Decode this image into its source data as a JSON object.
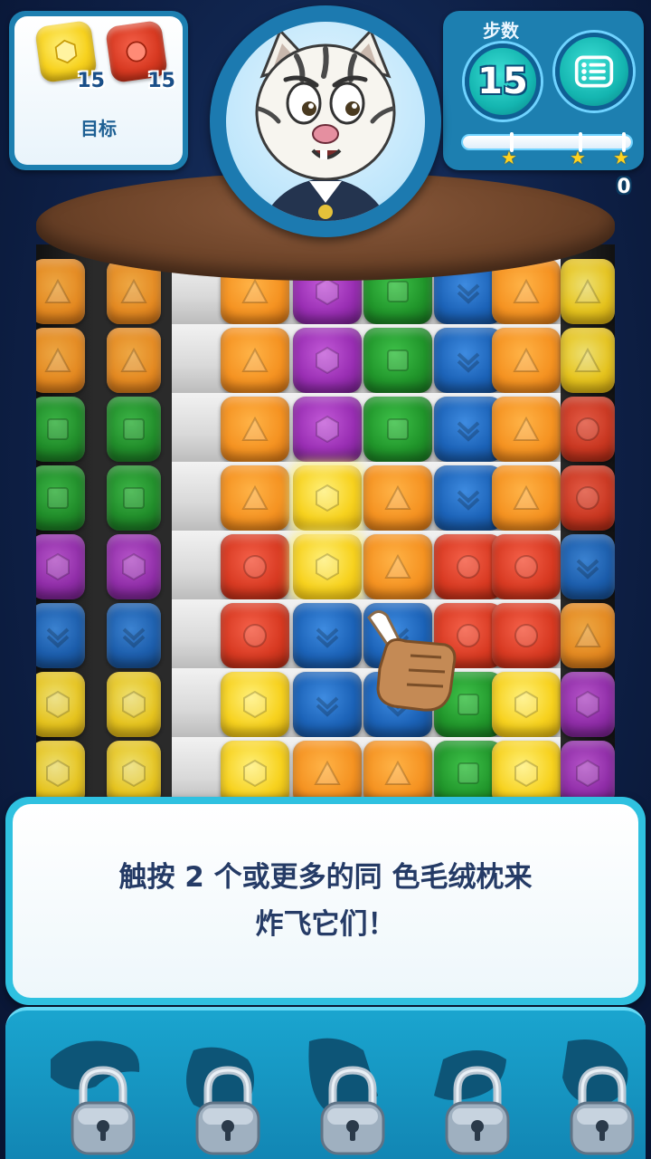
{
  "goal": {
    "label": "目标",
    "items": [
      {
        "color": "yellow",
        "icon": "hexagon-icon",
        "count": "15"
      },
      {
        "color": "red",
        "icon": "circle-icon",
        "count": "15"
      }
    ]
  },
  "moves": {
    "label": "步数",
    "value": "15"
  },
  "menu": {
    "icon": "menu-icon"
  },
  "score": {
    "value": "0",
    "stars": 3
  },
  "character": {
    "icon": "tiger-character"
  },
  "board": {
    "rows": [
      [
        "orange-triangle",
        "orange-triangle",
        "white",
        "orange-triangle",
        "purple-hexagon",
        "green-square",
        "blue-chevron",
        "orange-triangle",
        "yellow-triangle"
      ],
      [
        "orange-triangle",
        "orange-triangle",
        "white",
        "orange-triangle",
        "purple-hexagon",
        "green-square",
        "blue-chevron",
        "orange-triangle",
        "yellow-triangle"
      ],
      [
        "green-square",
        "green-square",
        "white",
        "orange-triangle",
        "purple-hexagon",
        "green-square",
        "blue-chevron",
        "orange-triangle",
        "red-circle"
      ],
      [
        "green-square",
        "green-square",
        "white",
        "orange-triangle",
        "yellow-hexagon",
        "orange-triangle",
        "blue-chevron",
        "orange-triangle",
        "red-circle"
      ],
      [
        "purple-hexagon",
        "purple-hexagon",
        "white",
        "red-circle",
        "yellow-hexagon",
        "orange-triangle",
        "red-circle",
        "red-circle",
        "blue-chevron"
      ],
      [
        "blue-chevron",
        "blue-chevron",
        "white",
        "red-circle",
        "blue-chevron",
        "blue-chevron",
        "red-circle",
        "red-circle",
        "orange-triangle"
      ],
      [
        "yellow-hexagon",
        "yellow-hexagon",
        "white",
        "yellow-hexagon",
        "blue-chevron",
        "blue-chevron",
        "green-square",
        "yellow-hexagon",
        "purple-hexagon"
      ],
      [
        "yellow-hexagon",
        "yellow-hexagon",
        "white",
        "yellow-hexagon",
        "orange-triangle",
        "orange-triangle",
        "green-square",
        "yellow-hexagon",
        "purple-hexagon"
      ]
    ],
    "highlighted": [
      [
        3,
        4
      ],
      [
        4,
        4
      ]
    ]
  },
  "tutorial": {
    "line1": "触按 2 个或更多的同 色毛绒枕来",
    "line2": "炸飞它们！"
  },
  "boosters": [
    {
      "icon": "lock-icon",
      "state": "locked"
    },
    {
      "icon": "lock-icon",
      "state": "locked"
    },
    {
      "icon": "lock-icon",
      "state": "locked"
    },
    {
      "icon": "lock-icon",
      "state": "locked"
    },
    {
      "icon": "lock-icon",
      "state": "locked"
    }
  ],
  "colors": {
    "hud_blue": "#1d7fb0",
    "accent_teal": "#14b5b0",
    "text_navy": "#253b66",
    "star_gold": "#ffd21f"
  }
}
